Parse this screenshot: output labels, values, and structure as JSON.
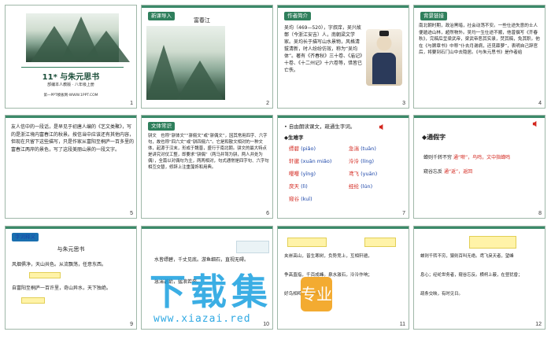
{
  "slides": [
    {
      "num": "1",
      "title": "11* 与朱元思书",
      "subtitle": "部编本人教版 · 八年级上册",
      "footer": "第一PPT模板网-WWW.1PPT.COM"
    },
    {
      "num": "2",
      "tag": "新课导入",
      "title": "富春江"
    },
    {
      "num": "3",
      "tag": "作者简介",
      "text": "吴均（469—520），字叔庠，吴兴故鄣（今浙江安吉）人，南朝梁文学家。吴均长于描写山水景物，风格清拔清新，时人纷纷仿效，称为“吴均体”。著有《齐春秋》三十卷、《庙记》十卷、《十二州记》十六卷等，惜皆已亡佚。"
    },
    {
      "num": "4",
      "tag": "背景链接",
      "text": "南北朝时期，政治黑暗，社会动荡不安。一些仕途失意的士人便遁迹山林，超然物外。吴均一生仕途不顺，他曾撰写《齐春秋》，完稿后呈梁武帝，梁武帝恶其实录，焚其稿，免其职。他在《与顾章书》中称“仆去月谢病，还觅薜萝”，表明自己辞官后，将要到石门山中去隐居。《与朱元思书》是作者给"
    },
    {
      "num": "5",
      "text": "友人信中的一段话，是早见于初唐人编的《艺文类聚》，写的是浙江境内富春江的秋景。按信当中应该还有其他内容，但现在只留下这些描写，只是作家从富阳至桐庐一百多里的富春江两岸的景色，写了这段美丽山景的一段文字。"
    },
    {
      "num": "6",
      "tag": "文体常识",
      "text": "骈文　也称“骈体文”“骈俪文”或“骈偶文”，因其常用四字、六字句，故也称“四六文”或“骈四俪六”。它是和散文相对的一种文体，起源于汉末，形成于魏晋，盛行于南北朝。骈文的最大特点是讲究对仗工整，即要求“骈偶”（两马并驾为骈，两人并处为偶），全篇以对偶句为主，两两相对，句式通常是四字句、六字句相互交替，修辞上注重藻饰和用典。"
    },
    {
      "num": "7",
      "bullet": "自由朗读课文，疏通生字词。",
      "heading": "生难字",
      "pairs": [
        {
          "w": "缥碧",
          "p": "piǎo",
          "w2": "急湍",
          "p2": "tuān"
        },
        {
          "w": "轩邈",
          "p": "xuān miǎo",
          "w2": "泠泠",
          "p2": "líng"
        },
        {
          "w": "嘤嘤",
          "p": "yīng",
          "w2": "鸢飞",
          "p2": "yuān"
        },
        {
          "w": "戾天",
          "p": "lì",
          "w2": "经纶",
          "p2": "lún"
        },
        {
          "w": "窥谷",
          "p": "kuī",
          "w2": "",
          "p2": ""
        }
      ]
    },
    {
      "num": "8",
      "heading": "通假字",
      "line1": "蝉则千转不穷",
      "note1": "通“啭”，鸟鸣，文中指蝉鸣",
      "line2": "窥谷忘反",
      "note2": "通“返”，返回"
    },
    {
      "num": "9",
      "tag": "字词释义",
      "title": "与朱元思书",
      "line1": "风烟俱净，天山共色。从流飘荡，任意东西。",
      "line2": "自富阳至桐庐一百许里，奇山异水，天下独绝。"
    },
    {
      "num": "10",
      "line1": "水皆缥碧，千丈见底。游鱼细石，直视无碍。",
      "line2": "急湍甚箭，猛浪若奔。"
    },
    {
      "num": "11",
      "line1": "夹岸高山，皆生寒树，负势竞上，互相轩邈，",
      "line2": "争高直指，千百成峰。泉水激石，泠泠作响；",
      "line3": "好鸟相鸣，嘤嘤成韵。"
    },
    {
      "num": "12",
      "line1": "蝉则千转不穷，猿则百叫无绝。鸢飞戾天者，望峰",
      "line2": "息心；经纶世务者，窥谷忘反。横柯上蔽，在昼犹昏；",
      "line3": "疏条交映，有时见日。"
    }
  ],
  "watermark": {
    "main": "下载集",
    "badge": "专业",
    "url": "www.xiazai.red"
  },
  "colors": {
    "border": "#9fb7a8",
    "accent_green": "#2f7f5c",
    "accent_blue": "#1a6fb0",
    "highlight_red": "#d3271e",
    "watermark_blue": "#1aa0e0",
    "watermark_orange": "#f2a21b"
  }
}
